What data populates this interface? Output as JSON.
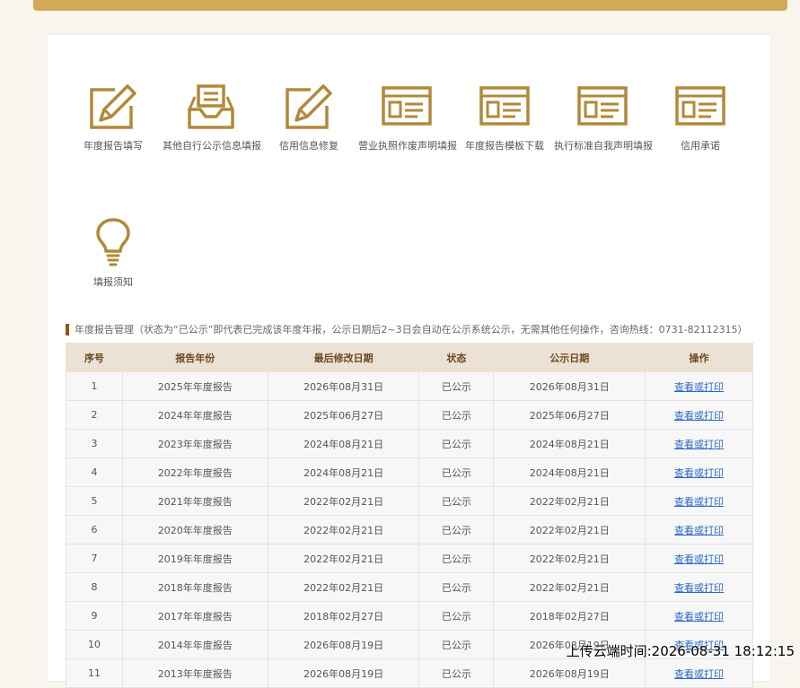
{
  "colors": {
    "brand": "#b08a3a",
    "header_bg": "#ece1d5",
    "link": "#2a6ac8"
  },
  "menu": [
    {
      "label": "年度报告填写",
      "icon": "edit-form-icon"
    },
    {
      "label": "其他自行公示信息填报",
      "icon": "inbox-tray-icon"
    },
    {
      "label": "信用信息修复",
      "icon": "edit-form-icon"
    },
    {
      "label": "营业执照作废声明填报",
      "icon": "browser-window-icon"
    },
    {
      "label": "年度报告模板下载",
      "icon": "browser-window-icon"
    },
    {
      "label": "执行标准自我声明填报",
      "icon": "browser-window-icon"
    },
    {
      "label": "信用承诺",
      "icon": "browser-window-icon"
    },
    {
      "label": "填报须知",
      "icon": "lightbulb-icon"
    }
  ],
  "reports": {
    "title": "年度报告管理（状态为“已公示”即代表已完成该年度年报，公示日期后2~3日会自动在公示系统公示，无需其他任何操作，咨询热线：0731-82112315）",
    "columns": [
      "序号",
      "报告年份",
      "最后修改日期",
      "状态",
      "公示日期",
      "操作"
    ],
    "rows": [
      [
        "1",
        "2025年年度报告",
        "2026年08月31日",
        "已公示",
        "2026年08月31日",
        "查看或打印"
      ],
      [
        "2",
        "2024年年度报告",
        "2025年06月27日",
        "已公示",
        "2025年06月27日",
        "查看或打印"
      ],
      [
        "3",
        "2023年年度报告",
        "2024年08月21日",
        "已公示",
        "2024年08月21日",
        "查看或打印"
      ],
      [
        "4",
        "2022年年度报告",
        "2024年08月21日",
        "已公示",
        "2024年08月21日",
        "查看或打印"
      ],
      [
        "5",
        "2021年年度报告",
        "2022年02月21日",
        "已公示",
        "2022年02月21日",
        "查看或打印"
      ],
      [
        "6",
        "2020年年度报告",
        "2022年02月21日",
        "已公示",
        "2022年02月21日",
        "查看或打印"
      ],
      [
        "7",
        "2019年年度报告",
        "2022年02月21日",
        "已公示",
        "2022年02月21日",
        "查看或打印"
      ],
      [
        "8",
        "2018年年度报告",
        "2022年02月21日",
        "已公示",
        "2022年02月21日",
        "查看或打印"
      ],
      [
        "9",
        "2017年年度报告",
        "2018年02月27日",
        "已公示",
        "2018年02月27日",
        "查看或打印"
      ],
      [
        "10",
        "2014年年度报告",
        "2026年08月19日",
        "已公示",
        "2026年08月19日",
        "查看或打印"
      ],
      [
        "11",
        "2013年年度报告",
        "2026年08月19日",
        "已公示",
        "2026年08月19日",
        "查看或打印"
      ]
    ]
  },
  "watermark": "上传云端时间:2026-08-31 18:12:15"
}
